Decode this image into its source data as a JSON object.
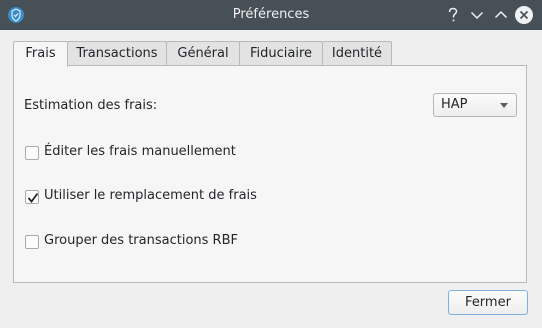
{
  "window": {
    "title": "Préférences",
    "app_icon": "shield-app-icon",
    "controls": [
      "help-icon",
      "minimize-icon",
      "maximize-icon",
      "close-icon"
    ]
  },
  "tabs": [
    {
      "label": "Frais",
      "active": true
    },
    {
      "label": "Transactions",
      "active": false
    },
    {
      "label": "Général",
      "active": false
    },
    {
      "label": "Fiduciaire",
      "active": false
    },
    {
      "label": "Identité",
      "active": false
    }
  ],
  "fees": {
    "estimation_label": "Estimation des frais:",
    "estimation_value": "HAP",
    "options": [
      {
        "label": "Éditer les frais manuellement",
        "checked": false
      },
      {
        "label": "Utiliser le remplacement de frais",
        "checked": true
      },
      {
        "label": "Grouper des transactions RBF",
        "checked": false
      }
    ]
  },
  "footer": {
    "close_label": "Fermer"
  },
  "colors": {
    "titlebar": "#475057",
    "accent": "#3daee9"
  }
}
